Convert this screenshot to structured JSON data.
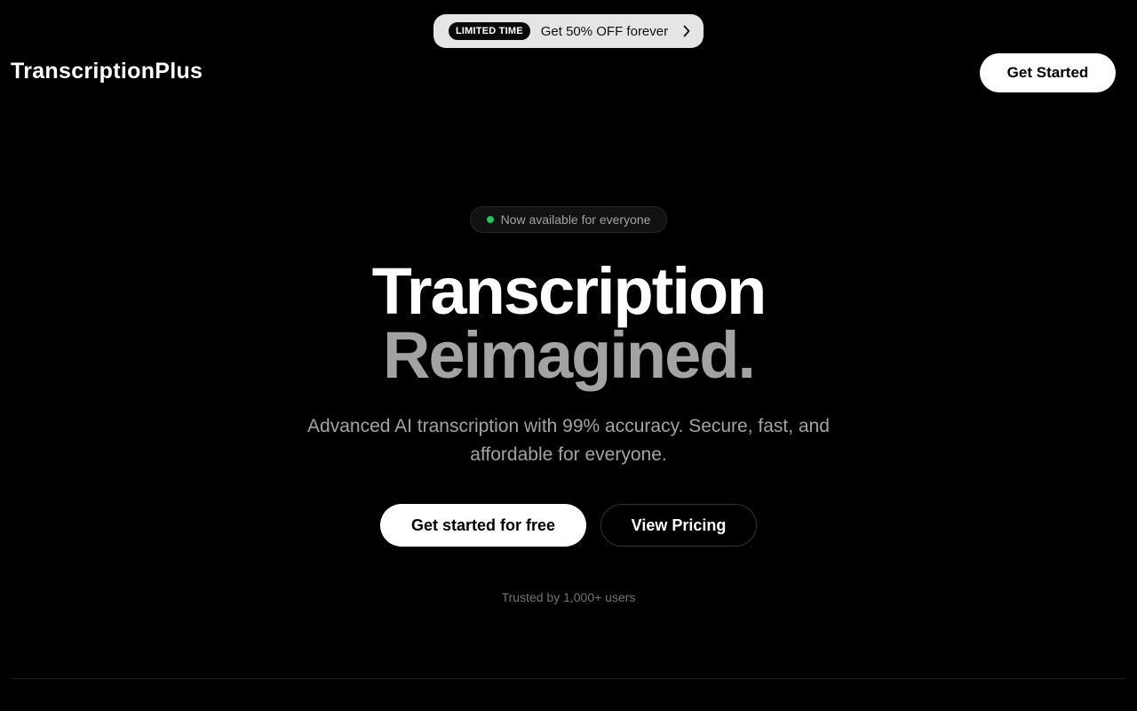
{
  "promo": {
    "badge": "LIMITED TIME",
    "text": "Get 50% OFF forever",
    "icon": "chevron-right-icon"
  },
  "header": {
    "logo": "TranscriptionPlus",
    "cta_label": "Get Started"
  },
  "hero": {
    "availability_text": "Now available for everyone",
    "title_line1": "Transcription",
    "title_line2": "Reimagined.",
    "subtitle": "Advanced AI transcription with 99% accuracy. Secure, fast, and affordable for everyone.",
    "primary_cta": "Get started for free",
    "secondary_cta": "View Pricing",
    "trusted_text": "Trusted by 1,000+ users"
  },
  "colors": {
    "background": "#000000",
    "foreground": "#ffffff",
    "muted": "#a3a3a3",
    "status_green": "#22c55e",
    "banner_bg": "#e5e5e5"
  }
}
